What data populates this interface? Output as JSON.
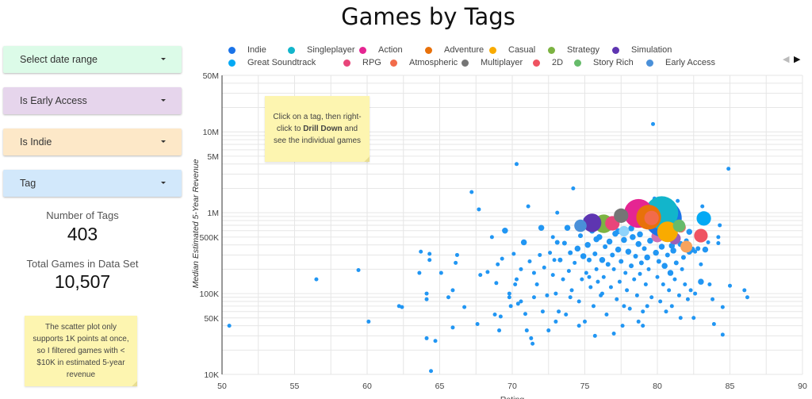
{
  "page": {
    "title": "Games by Tags"
  },
  "filters": [
    {
      "label": "Select date range",
      "color": "#dcfbe8"
    },
    {
      "label": "Is Early Access",
      "color": "#e6d5ec"
    },
    {
      "label": "Is Indie",
      "color": "#fde8c8"
    },
    {
      "label": "Tag",
      "color": "#d2e8fb"
    }
  ],
  "stats": {
    "tags_label": "Number of Tags",
    "tags_value": "403",
    "games_label": "Total Games in Data Set",
    "games_value": "10,507"
  },
  "notes": {
    "scatter_note": "The scatter plot only supports 1K points at once, so I filtered games with < $10K in estimated 5-year revenue",
    "drill_prefix": "Click on a tag, then right-click to ",
    "drill_bold": "Drill Down",
    "drill_suffix": " and see the individual games"
  },
  "legend_pager": {
    "prev_icon": "triangle-left-icon",
    "next_icon": "triangle-right-icon"
  },
  "chart_data": {
    "type": "scatter",
    "title": "Games by Tags",
    "xlabel": "Rating",
    "ylabel": "Median Estimated 5-Year Revenue",
    "xlim": [
      50,
      90
    ],
    "ylim": [
      10000,
      50000000
    ],
    "yscale": "log",
    "x_ticks": [
      "50",
      "55",
      "60",
      "65",
      "70",
      "75",
      "80",
      "85",
      "90"
    ],
    "x_tick_values": [
      50,
      55,
      60,
      65,
      70,
      75,
      80,
      85,
      90
    ],
    "y_ticks": [
      {
        "label": "10K",
        "value": 10000
      },
      {
        "label": "50K",
        "value": 50000
      },
      {
        "label": "100K",
        "value": 100000
      },
      {
        "label": "500K",
        "value": 500000
      },
      {
        "label": "1M",
        "value": 1000000
      },
      {
        "label": "5M",
        "value": 5000000
      },
      {
        "label": "10M",
        "value": 10000000
      },
      {
        "label": "50M",
        "value": 50000000
      }
    ],
    "grid": true,
    "legend_position": "top",
    "legend": [
      {
        "name": "Indie",
        "color": "#1a73e8"
      },
      {
        "name": "Singleplayer",
        "color": "#12b5cb"
      },
      {
        "name": "Action",
        "color": "#e52592"
      },
      {
        "name": "Adventure",
        "color": "#e8710a"
      },
      {
        "name": "Casual",
        "color": "#f9ab00"
      },
      {
        "name": "Strategy",
        "color": "#7cb342"
      },
      {
        "name": "Simulation",
        "color": "#5e35b1"
      },
      {
        "name": "Great Soundtrack",
        "color": "#03a9f4"
      },
      {
        "name": "RPG",
        "color": "#e8457a"
      },
      {
        "name": "Atmospheric",
        "color": "#f26b4a"
      },
      {
        "name": "Multiplayer",
        "color": "#757575"
      },
      {
        "name": "2D",
        "color": "#ef5361"
      },
      {
        "name": "Story Rich",
        "color": "#66bb6a"
      },
      {
        "name": "Early Access",
        "color": "#4a90d9"
      }
    ],
    "other_color": "#2196f3",
    "named_points": [
      {
        "tag": "Indie",
        "x": 80.4,
        "y": 850000,
        "size": 9
      },
      {
        "tag": "Singleplayer",
        "x": 80.3,
        "y": 1000000,
        "size": 8
      },
      {
        "tag": "Action",
        "x": 78.7,
        "y": 980000,
        "size": 7
      },
      {
        "tag": "Adventure",
        "x": 79.4,
        "y": 880000,
        "size": 6
      },
      {
        "tag": "Casual",
        "x": 80.7,
        "y": 580000,
        "size": 5
      },
      {
        "tag": "Strategy",
        "x": 76.3,
        "y": 730000,
        "size": 4.5
      },
      {
        "tag": "Simulation",
        "x": 75.5,
        "y": 750000,
        "size": 4.5
      },
      {
        "tag": "Great Soundtrack",
        "x": 83.2,
        "y": 850000,
        "size": 3.5
      },
      {
        "tag": "RPG",
        "x": 76.9,
        "y": 740000,
        "size": 3.5
      },
      {
        "tag": "Atmospheric",
        "x": 79.6,
        "y": 860000,
        "size": 3.5
      },
      {
        "tag": "Multiplayer",
        "x": 77.5,
        "y": 920000,
        "size": 3.5
      },
      {
        "tag": "2D",
        "x": 83.0,
        "y": 520000,
        "size": 3.3
      },
      {
        "tag": "Story Rich",
        "x": 81.5,
        "y": 690000,
        "size": 3
      },
      {
        "tag": "Early Access",
        "x": 74.7,
        "y": 690000,
        "size": 3
      }
    ],
    "extra_named_points": [
      {
        "color": "#ce6fb3",
        "x": 80.0,
        "y": 510000,
        "size": 2.5
      },
      {
        "color": "#9c5fb8",
        "x": 81.2,
        "y": 480000,
        "size": 2.5
      },
      {
        "color": "#f7a35c",
        "x": 82.0,
        "y": 380000,
        "size": 2.5
      },
      {
        "color": "#e57368",
        "x": 81.6,
        "y": 660000,
        "size": 2.2
      },
      {
        "color": "#ff7043",
        "x": 80.9,
        "y": 870000,
        "size": 3.3
      },
      {
        "color": "#8fd3fb",
        "x": 77.7,
        "y": 590000,
        "size": 2.2
      }
    ],
    "other_points": [
      [
        50.5,
        40000,
        1
      ],
      [
        56.5,
        150000,
        1
      ],
      [
        59.4,
        195000,
        1
      ],
      [
        60.1,
        45000,
        1
      ],
      [
        62.2,
        70000,
        1
      ],
      [
        62.4,
        68000,
        1
      ],
      [
        63.6,
        180000,
        1
      ],
      [
        63.7,
        330000,
        1
      ],
      [
        64.1,
        85000,
        1
      ],
      [
        64.1,
        100000,
        1
      ],
      [
        64.3,
        260000,
        1
      ],
      [
        64.3,
        310000,
        1
      ],
      [
        64.1,
        28000,
        1
      ],
      [
        64.4,
        11000,
        1
      ],
      [
        64.7,
        26000,
        1
      ],
      [
        65.1,
        180000,
        1
      ],
      [
        65.6,
        90000,
        1
      ],
      [
        65.9,
        110000,
        1
      ],
      [
        66.1,
        240000,
        1
      ],
      [
        66.2,
        300000,
        1
      ],
      [
        65.9,
        38000,
        1
      ],
      [
        66.7,
        68000,
        1
      ],
      [
        67.2,
        1800000,
        1
      ],
      [
        67.7,
        1100000,
        1
      ],
      [
        67.8,
        170000,
        1
      ],
      [
        67.6,
        42000,
        1
      ],
      [
        68.3,
        185000,
        1
      ],
      [
        68.6,
        500000,
        1
      ],
      [
        68.9,
        135000,
        1
      ],
      [
        68.8,
        55000,
        1
      ],
      [
        69.0,
        230000,
        1
      ],
      [
        69.2,
        52000,
        1
      ],
      [
        69.1,
        35000,
        1
      ],
      [
        69.3,
        270000,
        1
      ],
      [
        69.5,
        600000,
        1.5
      ],
      [
        69.8,
        90000,
        1
      ],
      [
        70.1,
        310000,
        1
      ],
      [
        69.9,
        70000,
        1
      ],
      [
        70.3,
        4000000,
        1
      ],
      [
        70.2,
        130000,
        1
      ],
      [
        70.4,
        75000,
        1
      ],
      [
        70.6,
        80000,
        1
      ],
      [
        70.8,
        430000,
        1.5
      ],
      [
        70.6,
        200000,
        1
      ],
      [
        71.1,
        1200000,
        1
      ],
      [
        70.9,
        56000,
        1
      ],
      [
        71.3,
        28000,
        1
      ],
      [
        71.4,
        24000,
        1
      ],
      [
        71.2,
        250000,
        1
      ],
      [
        71.5,
        180000,
        1
      ],
      [
        71.7,
        130000,
        1
      ],
      [
        71.9,
        300000,
        1
      ],
      [
        72.0,
        650000,
        1.5
      ],
      [
        72.1,
        60000,
        1
      ],
      [
        72.2,
        210000,
        1
      ],
      [
        72.4,
        95000,
        1
      ],
      [
        72.5,
        35000,
        1
      ],
      [
        72.6,
        320000,
        1
      ],
      [
        72.8,
        170000,
        1
      ],
      [
        72.9,
        260000,
        1
      ],
      [
        73.0,
        100000,
        1
      ],
      [
        73.1,
        1000000,
        1
      ],
      [
        73.2,
        60000,
        1
      ],
      [
        73.3,
        260000,
        1.2
      ],
      [
        73.5,
        150000,
        1
      ],
      [
        73.6,
        420000,
        1.2
      ],
      [
        73.7,
        55000,
        1
      ],
      [
        73.8,
        650000,
        1.5
      ],
      [
        73.9,
        190000,
        1
      ],
      [
        74.0,
        320000,
        1.2
      ],
      [
        74.1,
        110000,
        1
      ],
      [
        74.2,
        2000000,
        1
      ],
      [
        74.3,
        240000,
        1
      ],
      [
        74.5,
        360000,
        1.5
      ],
      [
        74.6,
        80000,
        1
      ],
      [
        74.7,
        520000,
        1.2
      ],
      [
        74.8,
        150000,
        1
      ],
      [
        74.9,
        290000,
        1.5
      ],
      [
        75.0,
        45000,
        1
      ],
      [
        75.1,
        180000,
        1
      ],
      [
        75.2,
        400000,
        1.5
      ],
      [
        75.3,
        260000,
        1.2
      ],
      [
        75.4,
        120000,
        1
      ],
      [
        75.5,
        600000,
        1.5
      ],
      [
        75.6,
        70000,
        1
      ],
      [
        75.7,
        310000,
        1.2
      ],
      [
        75.8,
        200000,
        1
      ],
      [
        75.9,
        140000,
        1
      ],
      [
        76.0,
        500000,
        1.5
      ],
      [
        76.1,
        95000,
        1
      ],
      [
        76.2,
        260000,
        1.5
      ],
      [
        76.3,
        160000,
        1
      ],
      [
        76.4,
        380000,
        1.2
      ],
      [
        76.5,
        55000,
        1
      ],
      [
        76.6,
        230000,
        1.2
      ],
      [
        76.7,
        440000,
        1.5
      ],
      [
        76.8,
        120000,
        1
      ],
      [
        76.9,
        300000,
        1.2
      ],
      [
        77.0,
        200000,
        1
      ],
      [
        77.1,
        550000,
        1.5
      ],
      [
        77.2,
        85000,
        1
      ],
      [
        77.3,
        350000,
        1.5
      ],
      [
        77.4,
        140000,
        1
      ],
      [
        77.5,
        250000,
        1.2
      ],
      [
        77.6,
        40000,
        1
      ],
      [
        77.7,
        460000,
        1.5
      ],
      [
        77.8,
        180000,
        1
      ],
      [
        77.9,
        110000,
        1
      ],
      [
        78.0,
        330000,
        1.5
      ],
      [
        78.1,
        65000,
        1
      ],
      [
        78.2,
        220000,
        1.2
      ],
      [
        78.3,
        500000,
        1.5
      ],
      [
        78.4,
        150000,
        1
      ],
      [
        78.5,
        290000,
        1.2
      ],
      [
        78.6,
        95000,
        1
      ],
      [
        78.7,
        410000,
        1.5
      ],
      [
        78.8,
        175000,
        1
      ],
      [
        78.9,
        240000,
        1.2
      ],
      [
        79.0,
        60000,
        1
      ],
      [
        79.1,
        360000,
        1.2
      ],
      [
        79.2,
        130000,
        1
      ],
      [
        79.3,
        280000,
        1.5
      ],
      [
        79.4,
        200000,
        1
      ],
      [
        79.5,
        450000,
        1.5
      ],
      [
        79.6,
        90000,
        1
      ],
      [
        79.7,
        12500000,
        1
      ],
      [
        79.8,
        1500000,
        1
      ],
      [
        79.9,
        320000,
        1.5
      ],
      [
        80.0,
        160000,
        1
      ],
      [
        80.1,
        250000,
        1.2
      ],
      [
        80.2,
        80000,
        1
      ],
      [
        80.3,
        380000,
        1.5
      ],
      [
        80.4,
        130000,
        1
      ],
      [
        80.5,
        220000,
        1.5
      ],
      [
        80.6,
        1400000,
        1
      ],
      [
        80.7,
        300000,
        1.2
      ],
      [
        80.8,
        110000,
        1
      ],
      [
        80.9,
        180000,
        1.5
      ],
      [
        81.0,
        70000,
        1
      ],
      [
        81.1,
        340000,
        1.5
      ],
      [
        81.2,
        150000,
        1
      ],
      [
        81.3,
        240000,
        1.2
      ],
      [
        81.4,
        1400000,
        1
      ],
      [
        81.5,
        95000,
        1
      ],
      [
        81.6,
        410000,
        1.5
      ],
      [
        81.7,
        200000,
        1
      ],
      [
        81.8,
        280000,
        1.2
      ],
      [
        81.9,
        130000,
        1
      ],
      [
        82.0,
        360000,
        1.5
      ],
      [
        82.1,
        85000,
        1
      ],
      [
        82.2,
        330000,
        1.5
      ],
      [
        82.3,
        110000,
        1
      ],
      [
        82.4,
        350000,
        1.5
      ],
      [
        82.6,
        100000,
        1
      ],
      [
        82.8,
        360000,
        1.2
      ],
      [
        83.0,
        140000,
        1.5
      ],
      [
        83.1,
        1200000,
        1
      ],
      [
        83.3,
        350000,
        1.5
      ],
      [
        83.6,
        130000,
        1
      ],
      [
        83.8,
        85000,
        1
      ],
      [
        84.2,
        500000,
        1
      ],
      [
        84.3,
        700000,
        1
      ],
      [
        84.5,
        68000,
        1
      ],
      [
        84.5,
        31000,
        1
      ],
      [
        84.9,
        3500000,
        1
      ],
      [
        85.0,
        125000,
        1
      ],
      [
        86.0,
        110000,
        1
      ],
      [
        86.2,
        90000,
        1
      ],
      [
        84.2,
        420000,
        1
      ],
      [
        83.5,
        430000,
        1
      ],
      [
        76.0,
        820000,
        1.5
      ],
      [
        74.5,
        700000,
        1.5
      ],
      [
        75.1,
        820000,
        1.5
      ],
      [
        75.8,
        470000,
        1.5
      ],
      [
        76.7,
        640000,
        1.2
      ],
      [
        77.6,
        860000,
        1.2
      ],
      [
        78.2,
        640000,
        1.5
      ],
      [
        78.5,
        750000,
        1.2
      ],
      [
        79.0,
        700000,
        1.2
      ],
      [
        79.2,
        1100000,
        1
      ],
      [
        80.2,
        1350000,
        1
      ],
      [
        81.7,
        640000,
        1.5
      ],
      [
        82.2,
        580000,
        1.5
      ],
      [
        82.6,
        330000,
        1
      ],
      [
        83.0,
        230000,
        1
      ],
      [
        82.0,
        450000,
        1.2
      ],
      [
        81.0,
        390000,
        1.5
      ],
      [
        77.3,
        590000,
        1.5
      ],
      [
        78.8,
        540000,
        1.5
      ],
      [
        73.1,
        430000,
        1.2
      ],
      [
        72.8,
        500000,
        1
      ],
      [
        75.3,
        160000,
        1
      ],
      [
        74.0,
        90000,
        1
      ],
      [
        76.2,
        100000,
        1
      ],
      [
        77.7,
        70000,
        1
      ],
      [
        79.3,
        70000,
        1
      ],
      [
        80.6,
        60000,
        1
      ],
      [
        81.6,
        50000,
        1
      ],
      [
        82.5,
        50000,
        1
      ],
      [
        83.9,
        42000,
        1
      ],
      [
        79.0,
        40000,
        1
      ],
      [
        77.0,
        32000,
        1
      ],
      [
        75.7,
        30000,
        1
      ],
      [
        78.7,
        45000,
        1
      ],
      [
        74.6,
        40000,
        1
      ],
      [
        73.0,
        45000,
        1
      ],
      [
        71.0,
        35000,
        1
      ],
      [
        69.8,
        100000,
        1
      ],
      [
        70.3,
        150000,
        1
      ],
      [
        71.5,
        90000,
        1
      ]
    ]
  }
}
